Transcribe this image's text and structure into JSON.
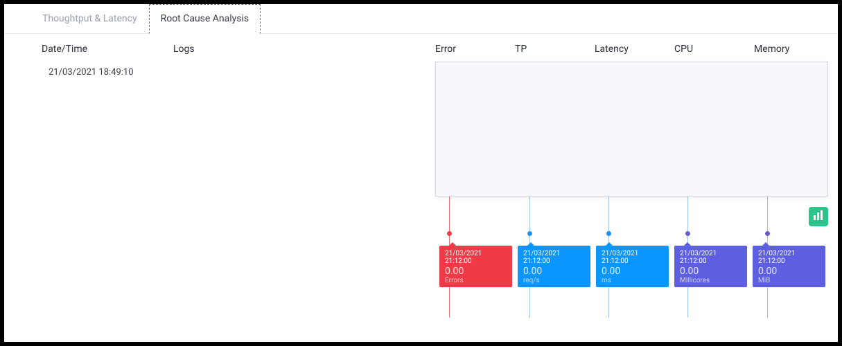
{
  "tabs": {
    "throughput": "Thoughtput & Latency",
    "rca": "Root Cause Analysis"
  },
  "headers": {
    "date": "Date/Time",
    "logs": "Logs",
    "error": "Error",
    "tp": "TP",
    "latency": "Latency",
    "cpu": "CPU",
    "memory": "Memory"
  },
  "row": {
    "datetime": "21/03/2021 18:49:10"
  },
  "metrics": {
    "positions": [
      20,
      136,
      250,
      364,
      479
    ],
    "tooltips": [
      {
        "color": "t-red",
        "time": "21/03/2021 21:12:00",
        "value": "0.00",
        "label": "Errors"
      },
      {
        "color": "t-blue",
        "time": "21/03/2021 21:12:00",
        "value": "0.00",
        "label": "req/s"
      },
      {
        "color": "t-blue",
        "time": "21/03/2021 21:12:00",
        "value": "0.00",
        "label": "ms"
      },
      {
        "color": "t-purple",
        "time": "21/03/2021 21:12:00",
        "value": "0.00",
        "label": "Millicores"
      },
      {
        "color": "t-purple",
        "time": "21/03/2021 21:12:00",
        "value": "0.00",
        "label": "MiB"
      }
    ]
  },
  "chart_data": {
    "type": "line",
    "series": [
      {
        "name": "Error",
        "unit": "Errors",
        "values": [
          0.0
        ]
      },
      {
        "name": "TP",
        "unit": "req/s",
        "values": [
          0.0
        ]
      },
      {
        "name": "Latency",
        "unit": "ms",
        "values": [
          0.0
        ]
      },
      {
        "name": "CPU",
        "unit": "Millicores",
        "values": [
          0.0
        ]
      },
      {
        "name": "Memory",
        "unit": "MiB",
        "values": [
          0.0
        ]
      }
    ],
    "x": [
      "21/03/2021 21:12:00"
    ],
    "title": "",
    "xlabel": "",
    "ylabel": ""
  }
}
